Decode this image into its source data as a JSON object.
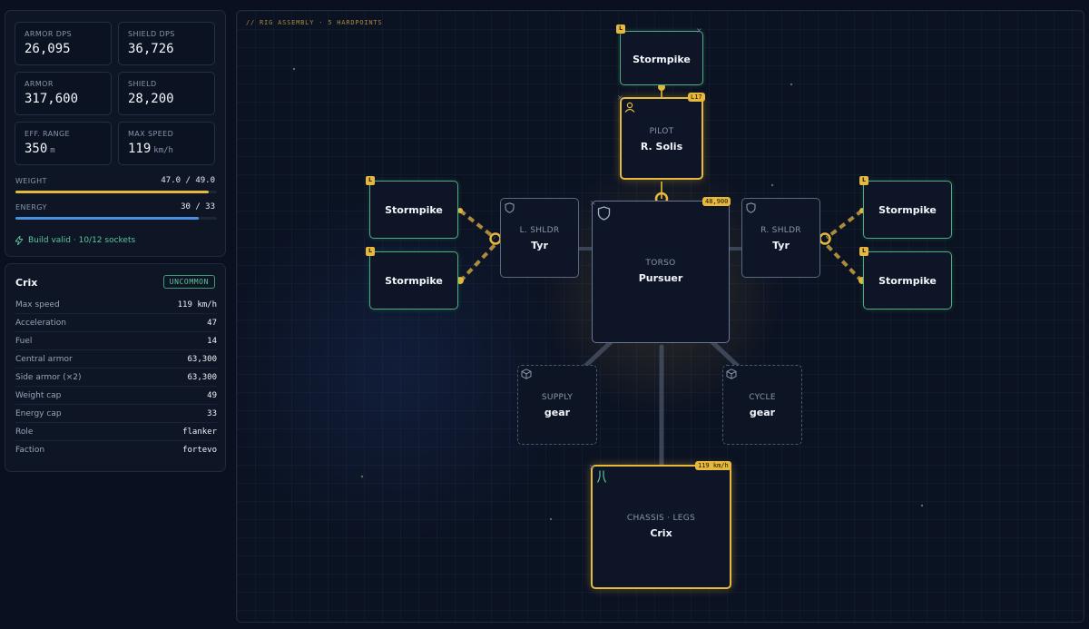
{
  "stats": {
    "armor_dps": {
      "label": "ARMOR DPS",
      "value": "26,095"
    },
    "shield_dps": {
      "label": "SHIELD DPS",
      "value": "36,726"
    },
    "armor": {
      "label": "ARMOR",
      "value": "317,600"
    },
    "shield": {
      "label": "SHIELD",
      "value": "28,200"
    },
    "eff_range": {
      "label": "EFF. RANGE",
      "value": "350",
      "unit": "m"
    },
    "max_speed": {
      "label": "MAX SPEED",
      "value": "119",
      "unit": "km/h"
    },
    "weight": {
      "label": "WEIGHT",
      "value": "47.0 / 49.0",
      "fraction": 0.959
    },
    "energy": {
      "label": "ENERGY",
      "value": "30 / 33",
      "fraction": 0.909
    },
    "valid_text": "Build valid · 10/12 sockets"
  },
  "spec": {
    "name": "Crix",
    "rarity": "UNCOMMON",
    "rows": [
      {
        "k": "Max speed",
        "v": "119 km/h"
      },
      {
        "k": "Acceleration",
        "v": "47"
      },
      {
        "k": "Fuel",
        "v": "14"
      },
      {
        "k": "Central armor",
        "v": "63,300"
      },
      {
        "k": "Side armor (×2)",
        "v": "63,300"
      },
      {
        "k": "Weight cap",
        "v": "49"
      },
      {
        "k": "Energy cap",
        "v": "33"
      },
      {
        "k": "Role",
        "v": "flanker"
      },
      {
        "k": "Faction",
        "v": "fortevo"
      }
    ]
  },
  "canvas": {
    "title": "// RIG ASSEMBLY · 5 HARDPOINTS",
    "weapon_tag": "L",
    "close_glyph": "×",
    "weapons": {
      "top": "Stormpike",
      "left_top": "Stormpike",
      "left_bottom": "Stormpike",
      "right_top": "Stormpike",
      "right_bottom": "Stormpike"
    },
    "pilot": {
      "role": "PILOT",
      "name": "R. Solis",
      "badge": "L17"
    },
    "left_shoulder": {
      "role": "L. SHLDR",
      "name": "Tyr"
    },
    "right_shoulder": {
      "role": "R. SHLDR",
      "name": "Tyr"
    },
    "torso": {
      "role": "TORSO",
      "name": "Pursuer",
      "badge": "48,900"
    },
    "supply": {
      "role": "SUPPLY",
      "name": "gear"
    },
    "cycle": {
      "role": "CYCLE",
      "name": "gear"
    },
    "chassis": {
      "role": "CHASSIS · LEGS",
      "name": "Crix",
      "badge": "119 km/h"
    }
  },
  "colors": {
    "accent_gold": "#e6b93c",
    "weapon_green": "#4cae7e",
    "energy_blue": "#4b8fe0",
    "valid_green": "#5ec39a"
  }
}
